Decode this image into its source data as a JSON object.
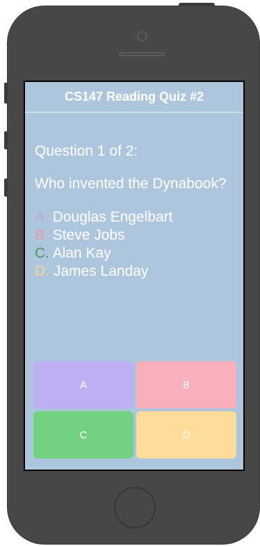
{
  "quiz": {
    "title": "CS147 Reading Quiz #2",
    "question_counter": "Question 1 of 2:",
    "question_text": "Who invented the Dynabook?",
    "options": [
      {
        "letter": "A.",
        "text": "Douglas Engelbart",
        "color": "#b9a8dc"
      },
      {
        "letter": "B.",
        "text": "Steve Jobs",
        "color": "#e49aa6"
      },
      {
        "letter": "C.",
        "text": "Alan Kay",
        "color": "#4e9a58"
      },
      {
        "letter": "D.",
        "text": "James Landay",
        "color": "#f4d890"
      }
    ],
    "answer_buttons": [
      {
        "label": "A",
        "color": "#bcaff2"
      },
      {
        "label": "B",
        "color": "#fab0bb"
      },
      {
        "label": "C",
        "color": "#72d27f"
      },
      {
        "label": "D",
        "color": "#fedc9a"
      }
    ]
  },
  "colors": {
    "screen_background": "#adc6de",
    "phone_body": "#474747"
  }
}
